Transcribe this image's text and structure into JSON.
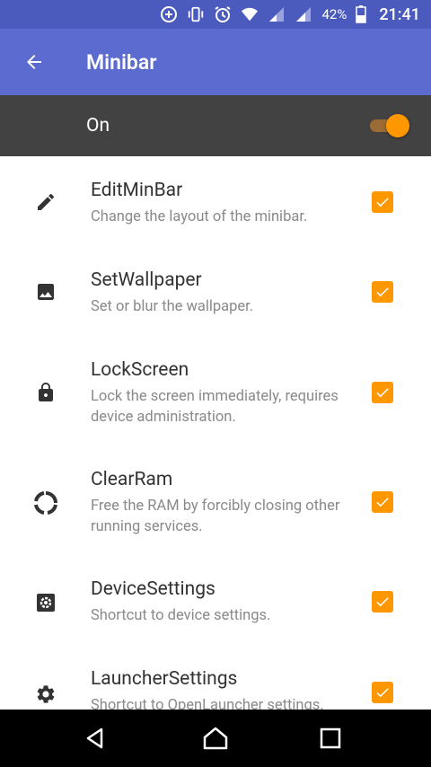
{
  "status_bar": {
    "battery_percent": "42%",
    "time": "21:41",
    "icons": [
      "data-saver-icon",
      "vibrate-icon",
      "alarm-icon",
      "wifi-icon",
      "signal-icon",
      "signal-icon",
      "battery-icon"
    ]
  },
  "app_bar": {
    "title": "Minibar"
  },
  "master_switch": {
    "label": "On",
    "checked": true
  },
  "items": [
    {
      "title": "EditMinBar",
      "summary": "Change the layout of the minibar.",
      "icon": "pencil-icon",
      "checked": true
    },
    {
      "title": "SetWallpaper",
      "summary": "Set or blur the wallpaper.",
      "icon": "image-icon",
      "checked": true
    },
    {
      "title": "LockScreen",
      "summary": "Lock the screen immediately, requires device administration.",
      "icon": "lock-icon",
      "checked": true
    },
    {
      "title": "ClearRam",
      "summary": "Free the RAM by forcibly closing other running services.",
      "icon": "circle-arrows-icon",
      "checked": true
    },
    {
      "title": "DeviceSettings",
      "summary": "Shortcut to device settings.",
      "icon": "settings-box-icon",
      "checked": true
    },
    {
      "title": "LauncherSettings",
      "summary": "Shortcut to OpenLauncher settings.",
      "icon": "gear-icon",
      "checked": true
    }
  ],
  "colors": {
    "primary": "#5c6bd0",
    "status": "#4a5bbd",
    "accent": "#ff9800",
    "dark_bar": "#424242"
  },
  "nav_bar": {
    "buttons": [
      "back-icon",
      "home-icon",
      "recents-icon"
    ]
  }
}
